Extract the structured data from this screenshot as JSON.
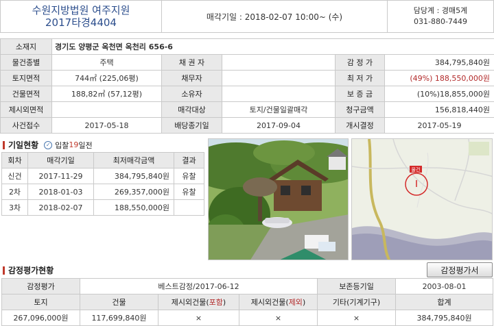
{
  "header": {
    "court": "수원지방법원 여주지원",
    "case_no": "2017타경4404",
    "sale_date": "매각기일 : 2018-02-07  10:00~ (수)",
    "dept": "담당계 : 경매5계",
    "phone": "031-880-7449"
  },
  "info": {
    "location_label": "소재지",
    "location": "경기도 양평군 옥천면 옥천리 656-6",
    "type_label": "물건종별",
    "type": "주택",
    "creditor_label": "채 권 자",
    "creditor": "",
    "appraisal_label": "감 정 가",
    "appraisal": "384,795,840원",
    "land_label": "토지면적",
    "land": "744㎡ (225,06평)",
    "debtor_label": "채무자",
    "debtor": "",
    "min_price_label": "최 저 가",
    "min_price": "(49%) 188,550,000원",
    "building_label": "건물면적",
    "building": "188,82㎡ (57,12평)",
    "owner_label": "소유자",
    "owner": "",
    "deposit_label": "보 증 금",
    "deposit": "(10%)18,855,000원",
    "excluded_label": "제시외면적",
    "excluded": "",
    "target_label": "매각대상",
    "target": "토지/건물일괄매각",
    "claim_label": "청구금액",
    "claim": "156,818,440원",
    "received_label": "사건접수",
    "received": "2017-05-18",
    "dividend_label": "배당종기일",
    "dividend": "2017-09-04",
    "start_label": "개시결정",
    "start": "2017-05-19"
  },
  "history": {
    "title": "기일현황",
    "badge_pre": "입찰",
    "badge_num": "19",
    "badge_post": "일전",
    "headers": [
      "회차",
      "매각기일",
      "최저매각금액",
      "결과"
    ],
    "rows": [
      [
        "신건",
        "2017-11-29",
        "384,795,840원",
        "유찰"
      ],
      [
        "2차",
        "2018-01-03",
        "269,357,000원",
        "유찰"
      ],
      [
        "3차",
        "2018-02-07",
        "188,550,000원",
        ""
      ]
    ]
  },
  "map": {
    "marker_label": "물건"
  },
  "appraisal_section": {
    "title": "감정평가현황",
    "button": "감정평가서",
    "row1_label": "감정평가",
    "row1_value": "베스트감정/2017-06-12",
    "row1_label2": "보존등기일",
    "row1_value2": "2003-08-01",
    "headers_pre": [
      "토지",
      "건물"
    ],
    "h3_pre": "제시외건물(",
    "h3_red": "포함",
    "h4_pre": "제시외건물(",
    "h4_red": "제외",
    "h_post": ")",
    "h5": "기타(기계기구)",
    "h6": "합계",
    "values": [
      "267,096,000원",
      "117,699,840원",
      "×",
      "×",
      "×",
      "384,795,840원"
    ]
  },
  "colors": {
    "accent_red": "#b22a2a",
    "header_blue": "#2b4d8c",
    "label_bg": "#e9e9e9"
  }
}
